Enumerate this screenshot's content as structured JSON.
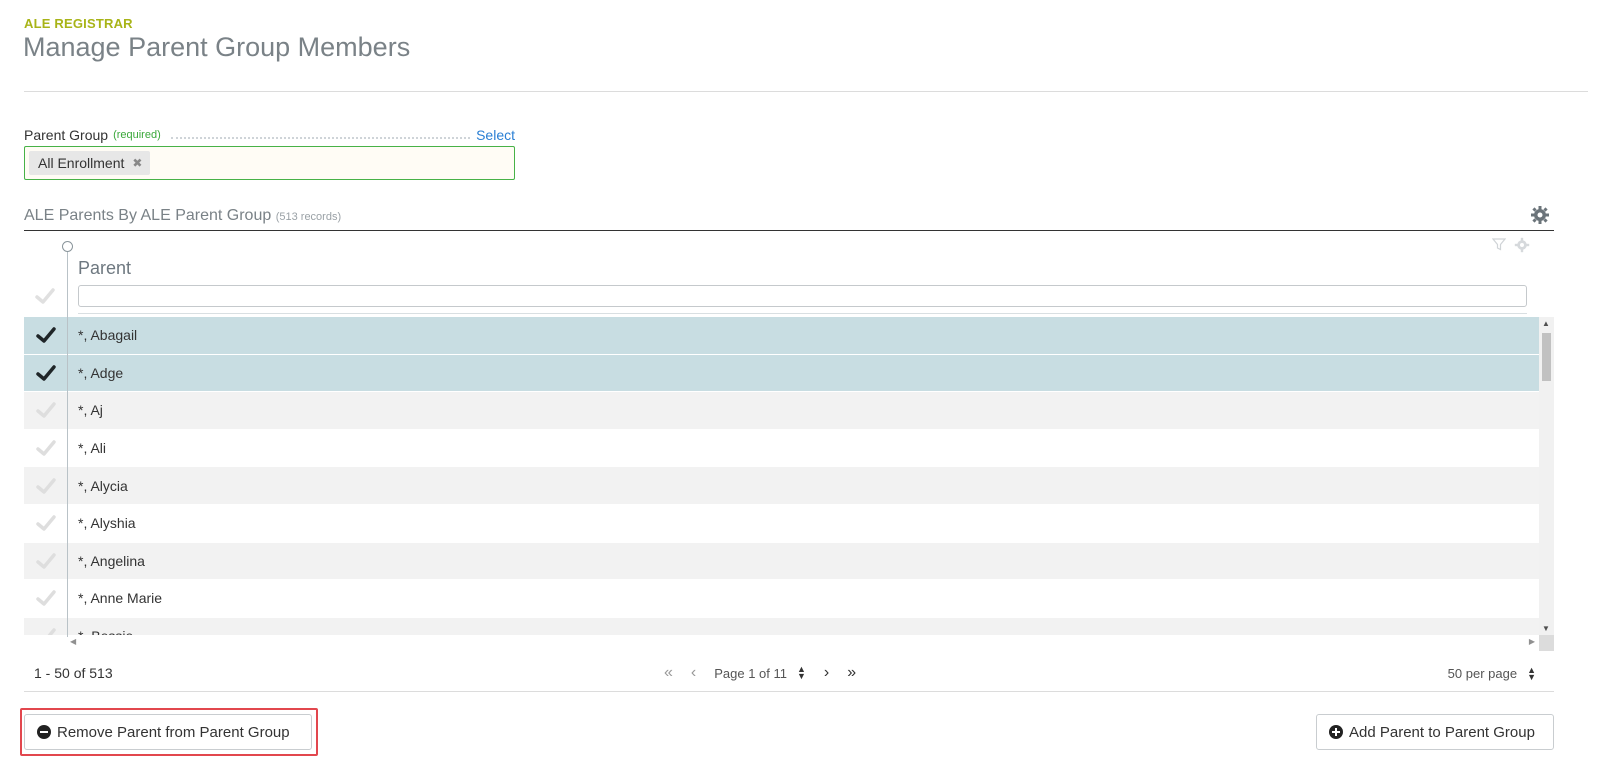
{
  "header": {
    "app_label": "ALE REGISTRAR",
    "title": "Manage Parent Group Members"
  },
  "parent_group_field": {
    "label": "Parent Group",
    "required_label": "(required)",
    "select_link": "Select",
    "tokens": [
      "All Enrollment"
    ],
    "token_remove_glyph": "✖"
  },
  "section": {
    "title": "ALE Parents By ALE Parent Group",
    "count": "(513 records)",
    "gear_icon": "gear-icon"
  },
  "grid": {
    "column_header": "Parent",
    "filter_placeholder": "",
    "header_icons": [
      "filter-icon",
      "gear-icon"
    ],
    "rows": [
      {
        "name": "*, Abagail",
        "selected": true
      },
      {
        "name": "*, Adge",
        "selected": true
      },
      {
        "name": "*, Aj",
        "selected": false
      },
      {
        "name": "*, Ali",
        "selected": false
      },
      {
        "name": "*, Alycia",
        "selected": false
      },
      {
        "name": "*, Alyshia",
        "selected": false
      },
      {
        "name": "*, Angelina",
        "selected": false
      },
      {
        "name": "*, Anne Marie",
        "selected": false
      },
      {
        "name": "*, Bessie",
        "selected": false
      }
    ]
  },
  "pager": {
    "range": "1 - 50 of 513",
    "page_label": "Page 1 of 11",
    "per_page": "50 per page"
  },
  "actions": {
    "remove_label": "Remove Parent from Parent Group",
    "add_label": "Add Parent to Parent Group"
  },
  "colors": {
    "accent_green": "#a8b418",
    "required_green": "#3aa83a",
    "link_blue": "#2a7fd4",
    "selected_row": "#c8dde2",
    "highlight_red": "#e2474e"
  }
}
